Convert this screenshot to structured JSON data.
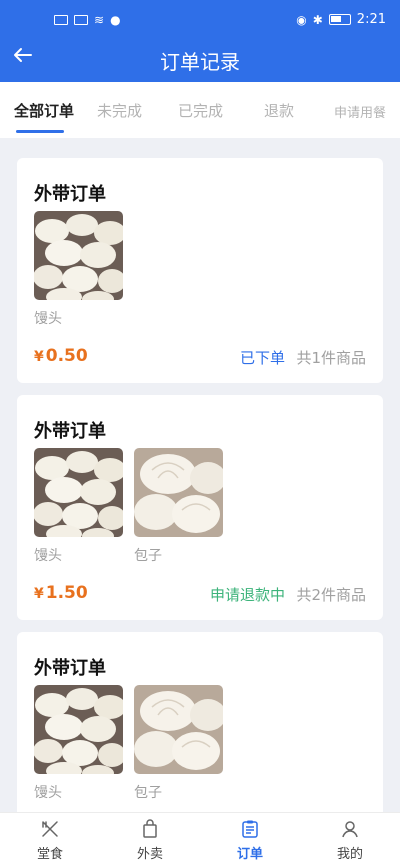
{
  "status_bar": {
    "time": "2:21"
  },
  "header": {
    "title": "订单记录",
    "back_icon": "back-arrow-icon"
  },
  "tabs": [
    {
      "label": "全部订单",
      "active": true
    },
    {
      "label": "未完成"
    },
    {
      "label": "已完成"
    },
    {
      "label": "退款"
    },
    {
      "label": "申请用餐"
    }
  ],
  "orders": [
    {
      "title": "外带订单",
      "items": [
        {
          "name": "馒头"
        }
      ],
      "currency": "¥",
      "price": "0.50",
      "status": "已下单",
      "status_color": "#2f6fe8",
      "count": "共1件商品"
    },
    {
      "title": "外带订单",
      "items": [
        {
          "name": "馒头"
        },
        {
          "name": "包子"
        }
      ],
      "currency": "¥",
      "price": "1.50",
      "status": "申请退款中",
      "status_color": "#3cb37a",
      "count": "共2件商品"
    },
    {
      "title": "外带订单",
      "items": [
        {
          "name": "馒头"
        },
        {
          "name": "包子"
        }
      ]
    }
  ],
  "bottom_nav": [
    {
      "label": "堂食",
      "icon": "dine-in-icon"
    },
    {
      "label": "外卖",
      "icon": "takeout-bag-icon"
    },
    {
      "label": "订单",
      "icon": "orders-icon",
      "active": true
    },
    {
      "label": "我的",
      "icon": "profile-icon"
    }
  ],
  "colors": {
    "accent": "#2f6fe8",
    "price": "#e8711e",
    "refund": "#3cb37a"
  }
}
